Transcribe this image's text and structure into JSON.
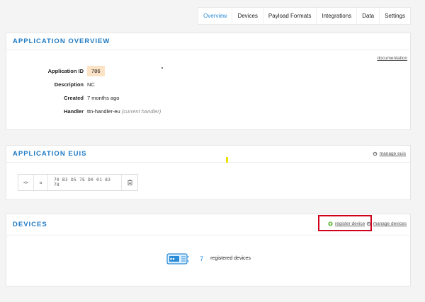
{
  "tabs": [
    {
      "label": "Overview",
      "active": true
    },
    {
      "label": "Devices"
    },
    {
      "label": "Payload Formats"
    },
    {
      "label": "Integrations"
    },
    {
      "label": "Data"
    },
    {
      "label": "Settings"
    }
  ],
  "overview": {
    "title": "APPLICATION OVERVIEW",
    "doc_link": "documentation",
    "fields": {
      "app_id": {
        "label": "Application ID",
        "value": "786"
      },
      "description": {
        "label": "Description",
        "value": "NC"
      },
      "created": {
        "label": "Created",
        "value": "7 months ago"
      },
      "handler": {
        "label": "Handler",
        "value": "ttn-handler-eu",
        "hint": "(current handler)"
      }
    }
  },
  "euis": {
    "title": "APPLICATION EUIS",
    "manage_link": "manage euis",
    "value": "70 B3 D5 7E D0 01 83 78",
    "toggle_icon": "<>",
    "swap_icon": "⇆",
    "copy_icon": "clipboard-icon"
  },
  "devices": {
    "title": "DEVICES",
    "register_link": "register device",
    "manage_link": "manage devices",
    "count": "7",
    "count_label": "registered devices"
  },
  "colors": {
    "accent": "#1e7ac4",
    "badge_bg": "#fde3c6",
    "badge_text": "#d9822b",
    "highlight_border": "#d0021b"
  }
}
